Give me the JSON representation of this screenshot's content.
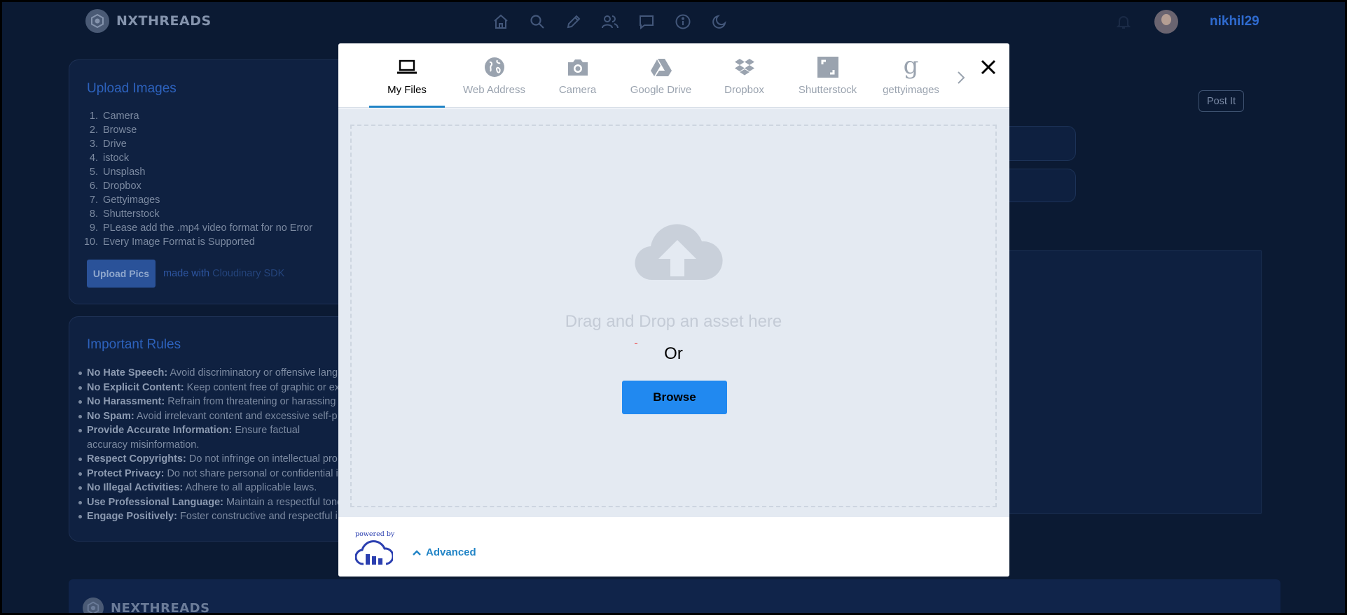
{
  "app": {
    "brand": "NXTHREADS",
    "username": "nikhil29",
    "footer_brand": "NEXTHREADS"
  },
  "nav": {
    "icons": [
      "home-icon",
      "search-icon",
      "pencil-icon",
      "users-icon",
      "chat-icon",
      "info-icon",
      "moon-icon"
    ]
  },
  "upload_card": {
    "title": "Upload Images",
    "items": [
      "Camera",
      "Browse",
      "Drive",
      "istock",
      "Unsplash",
      "Dropbox",
      "Gettyimages",
      "Shutterstock",
      "PLease add the .mp4 video format for no Error",
      "Every Image Format is Supported"
    ],
    "button_label": "Upload Pics",
    "made_with_prefix": "made with",
    "made_with_link": "Cloudinary SDK"
  },
  "rules_card": {
    "title": "Important Rules",
    "rules": [
      {
        "bold": "No Hate Speech:",
        "text": " Avoid discriminatory or offensive lang"
      },
      {
        "bold": "No Explicit Content:",
        "text": " Keep content free of graphic or ex"
      },
      {
        "bold": "No Harassment:",
        "text": " Refrain from threatening or harassing"
      },
      {
        "bold": "No Spam:",
        "text": " Avoid irrelevant content and excessive self-p"
      },
      {
        "bold": "Provide Accurate Information:",
        "text": " Ensure factual accuracy misinformation."
      },
      {
        "bold": "Respect Copyrights:",
        "text": " Do not infringe on intellectual pro"
      },
      {
        "bold": "Protect Privacy:",
        "text": " Do not share personal or confidential i"
      },
      {
        "bold": "No Illegal Activities:",
        "text": " Adhere to all applicable laws."
      },
      {
        "bold": "Use Professional Language:",
        "text": " Maintain a respectful tone"
      },
      {
        "bold": "Engage Positively:",
        "text": " Foster constructive and respectful i"
      }
    ]
  },
  "post_button": "Post It",
  "widget": {
    "tabs": [
      {
        "label": "My Files",
        "icon": "laptop-icon"
      },
      {
        "label": "Web Address",
        "icon": "globe-icon"
      },
      {
        "label": "Camera",
        "icon": "camera-icon"
      },
      {
        "label": "Google Drive",
        "icon": "google-drive-icon"
      },
      {
        "label": "Dropbox",
        "icon": "dropbox-icon"
      },
      {
        "label": "Shutterstock",
        "icon": "shutterstock-icon"
      },
      {
        "label": "gettyimages",
        "icon": "gettyimages-icon"
      }
    ],
    "active_tab": "My Files",
    "drag_text": "Drag and Drop an asset here",
    "or_text": "Or",
    "browse_label": "Browse",
    "powered_by": "powered by",
    "advanced_label": "Advanced"
  },
  "colors": {
    "page_bg": "#0b1a33",
    "accent": "#2184c6",
    "browse_button": "#2189f0",
    "drop_area_bg": "#e4eaf2"
  }
}
